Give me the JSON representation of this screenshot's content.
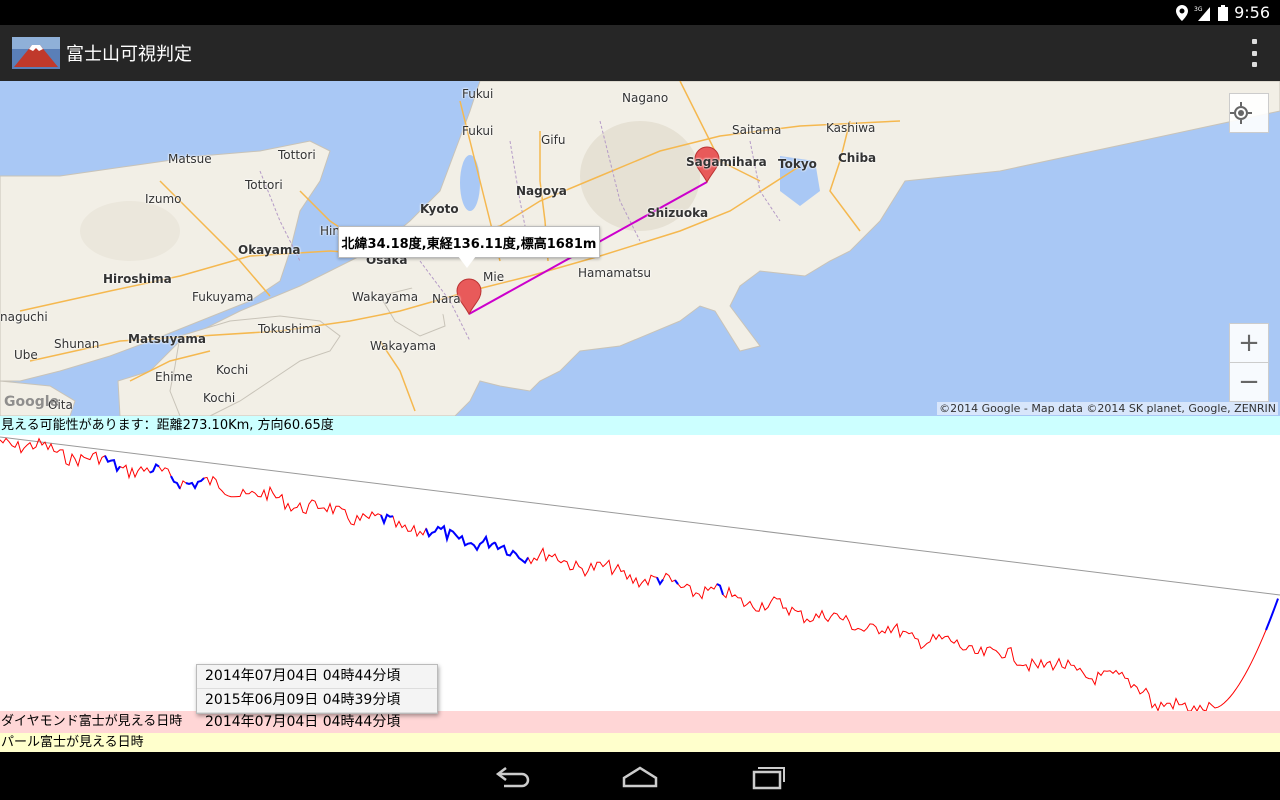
{
  "status_bar": {
    "time": "9:56",
    "icons": [
      "location-icon",
      "signal-3g-icon",
      "battery-icon"
    ]
  },
  "app": {
    "title": "富士山可視判定"
  },
  "map": {
    "info_window": "北緯34.18度,東経136.11度,標高1681m",
    "copyright": "©2014 Google - Map data ©2014 SK planet, Google, ZENRIN",
    "logo": "Google",
    "labels": [
      "Fukui",
      "Nagano",
      "Saitama",
      "Kashiwa",
      "Fukui",
      "Gifu",
      "Sagamihara",
      "Tokyo",
      "Chiba",
      "Matsue",
      "Tottori",
      "Tottori",
      "Nagoya",
      "Izumo",
      "Kyoto",
      "Shizuoka",
      "Hin",
      "Okayama",
      "Osaka",
      "Mie",
      "Hamamatsu",
      "Hiroshima",
      "Nara",
      "Fukuyama",
      "Wakayama",
      "Tokushima",
      "naguchi",
      "Shunan",
      "Matsuyama",
      "Wakayama",
      "Ube",
      "Ehime",
      "Kochi",
      "Oita",
      "Kochi"
    ]
  },
  "result": {
    "text": "見える可能性があります：距離273.10Km, 方向60.65度"
  },
  "diamond": {
    "label": "ダイヤモンド富士が見える日時",
    "value": "2014年07月04日 04時44分頃"
  },
  "pearl": {
    "label": "パール富士が見える日時"
  },
  "dropdown": {
    "options": [
      "2014年07月04日 04時44分頃",
      "2015年06月09日 04時39分頃"
    ]
  },
  "colors": {
    "terrain_line": "#ff0000",
    "visible_segment": "#0000ff",
    "sightline": "#999999",
    "route": "#cc00cc",
    "result_bg": "#ccffff",
    "diamond_bg": "#ffd6d6",
    "pearl_bg": "#ffffcc"
  }
}
